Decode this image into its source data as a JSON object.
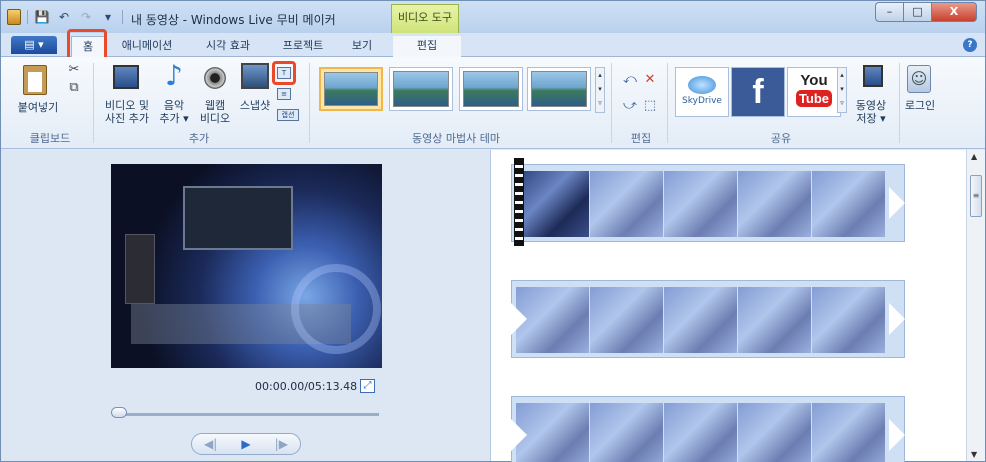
{
  "title": "내 동영상 - Windows Live 무비 메이커",
  "context_tab": "비디오 도구",
  "window_buttons": {
    "minimize": "–",
    "maximize": "□",
    "close": "X"
  },
  "file_menu_label": "▤ ▾",
  "tabs": [
    {
      "label": "홈"
    },
    {
      "label": "애니메이션"
    },
    {
      "label": "시각 효과"
    },
    {
      "label": "프로젝트"
    },
    {
      "label": "보기"
    },
    {
      "label": "편집"
    }
  ],
  "help_label": "?",
  "ribbon": {
    "clipboard": {
      "paste": "붙여넣기",
      "group": "클립보드"
    },
    "add": {
      "video_photo": [
        "비디오 및",
        "사진 추가"
      ],
      "music": [
        "음악",
        "추가 ▾"
      ],
      "webcam": [
        "웹캠",
        "비디오"
      ],
      "snapshot": "스냅샷",
      "caption_btn": "캡션",
      "group": "추가"
    },
    "themes": {
      "group": "동영상 마법사 테마"
    },
    "edit": {
      "group": "편집"
    },
    "share": {
      "skydrive": "SkyDrive",
      "facebook": "f",
      "youtube_you": "You",
      "youtube_tube": "Tube",
      "save_movie": [
        "동영상",
        "저장 ▾"
      ],
      "group": "공유"
    },
    "login": "로그인"
  },
  "preview": {
    "timecode": "00:00.00/05:13.48",
    "progress": 0
  },
  "colors": {
    "highlight": "#e84a2a",
    "context_tab": "#cfe37a"
  }
}
